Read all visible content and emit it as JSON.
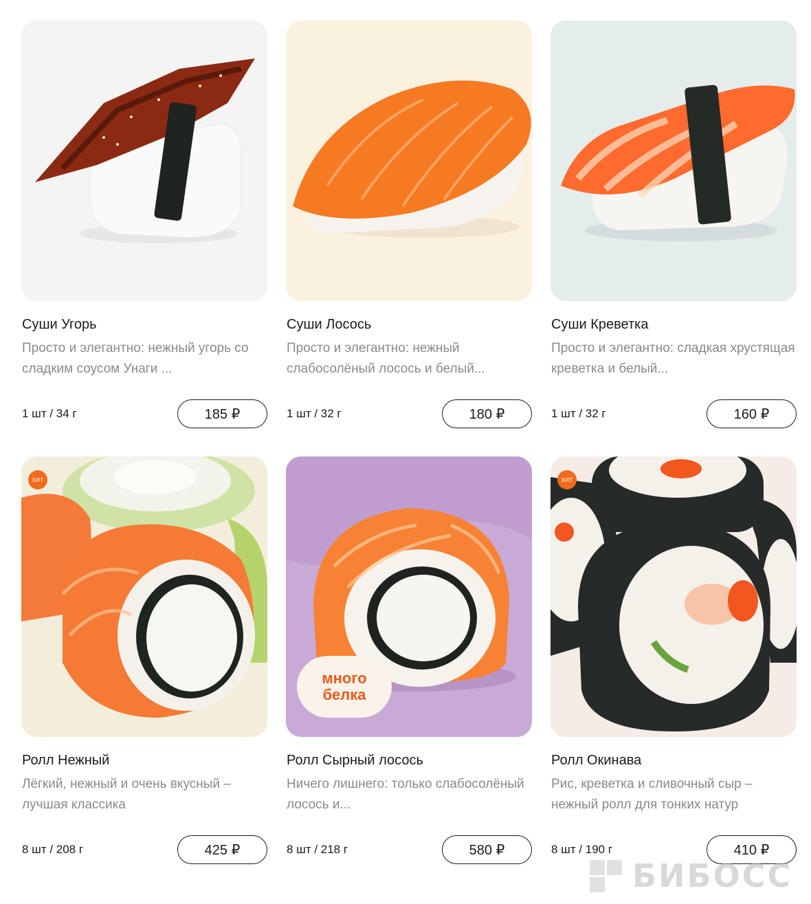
{
  "products": [
    {
      "title": "Суши Угорь",
      "description": "Просто и элегантно: нежный угорь со сладким соусом Унаги ...",
      "weight": "1 шт / 34 г",
      "price": "185 ₽",
      "image_icon": "eel-sushi-image",
      "bg": "#f4f4f4"
    },
    {
      "title": "Суши Лосось",
      "description": "Просто и элегантно: нежный слабосолёный лосось и белый...",
      "weight": "1 шт / 32 г",
      "price": "180 ₽",
      "image_icon": "salmon-sushi-image",
      "bg": "#fbf1df"
    },
    {
      "title": "Суши Креветка",
      "description": "Просто и элегантно: сладкая хрустящая креветка и белый...",
      "weight": "1 шт / 32 г",
      "price": "160 ₽",
      "image_icon": "shrimp-sushi-image",
      "bg": "#e4ecec"
    },
    {
      "title": "Ролл Нежный",
      "description": "Лёгкий, нежный и очень вкусный – лучшая классика",
      "weight": "8 шт / 208 г",
      "price": "425 ₽",
      "badge": "ХИТ",
      "image_icon": "salmon-roll-image",
      "bg": "#f3eedc"
    },
    {
      "title": "Ролл Сырный лосось",
      "description": "Ничего лишнего: только слабосолёный лосось и...",
      "weight": "8 шт / 218 г",
      "price": "580 ₽",
      "badge_line1": "много",
      "badge_line2": "белка",
      "image_icon": "cheese-salmon-roll-image",
      "bg": "#c9a9d6"
    },
    {
      "title": "Ролл Окинава",
      "description": "Рис, креветка и сливочный сыр – нежный ролл для тонких натур",
      "weight": "8 шт / 190 г",
      "price": "410 ₽",
      "badge": "ХИТ",
      "image_icon": "okinawa-roll-image",
      "bg": "#f6ece6"
    }
  ],
  "watermark": "БИБОСС",
  "colors": {
    "accent": "#f26b1d",
    "text": "#1a1a1a",
    "muted": "#8a8a8a"
  }
}
